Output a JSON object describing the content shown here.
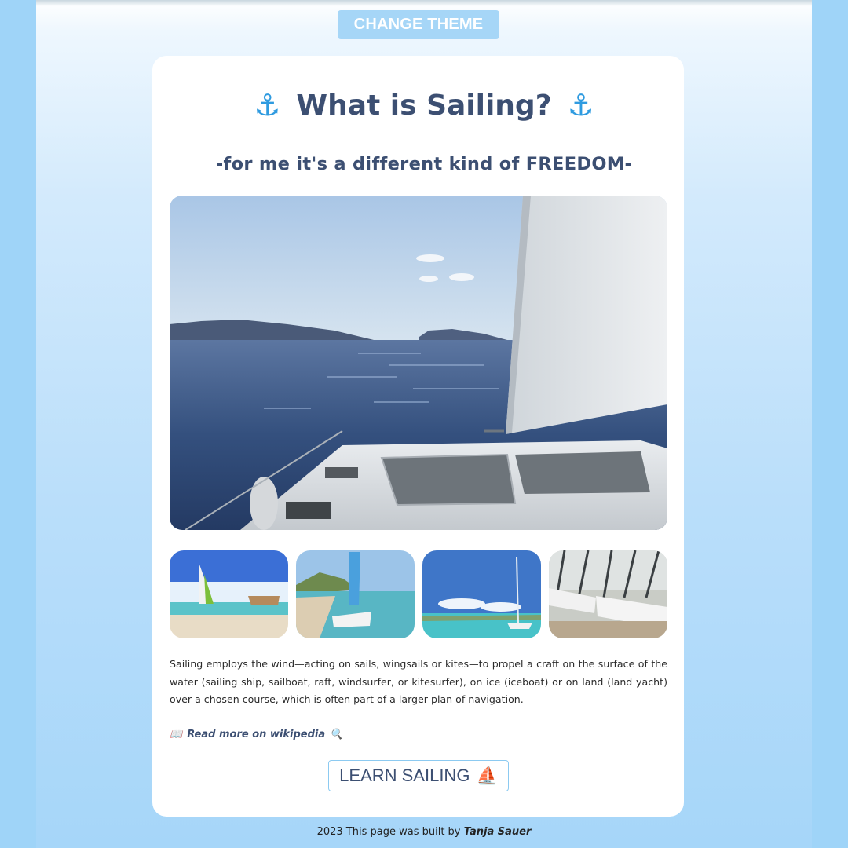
{
  "header": {
    "theme_button_label": "CHANGE THEME"
  },
  "card": {
    "title": "What is Sailing?",
    "title_icon": "anchor-icon",
    "subtitle": "-for me it's a different kind of FREEDOM-",
    "hero_image": "catamaran-deck-sea-photo",
    "thumbnails": [
      "beach-catamaran-photo",
      "bay-sailboat-photo",
      "island-sailboat-photo",
      "docked-catamarans-photo"
    ],
    "description": "Sailing employs the wind—acting on sails, wingsails or kites—to propel a craft on the surface of the water (sailing ship, sailboat, raft, windsurfer, or kitesurfer), on ice (iceboat) or on land (land yacht) over a chosen course, which is often part of a larger plan of navigation.",
    "wiki_link": {
      "icon_left": "book-icon",
      "label": "Read more on wikipedia",
      "icon_right": "magnifier-icon"
    },
    "learn_button": {
      "label": "LEARN SAILING",
      "icon": "sailboat-icon"
    }
  },
  "footer": {
    "text": "2023 This page was built by",
    "author": "Tanja Sauer"
  },
  "colors": {
    "accent": "#a6d6f7",
    "title": "#3c4f72",
    "anchor": "#2f9be0",
    "background": "#9fd4f8"
  }
}
